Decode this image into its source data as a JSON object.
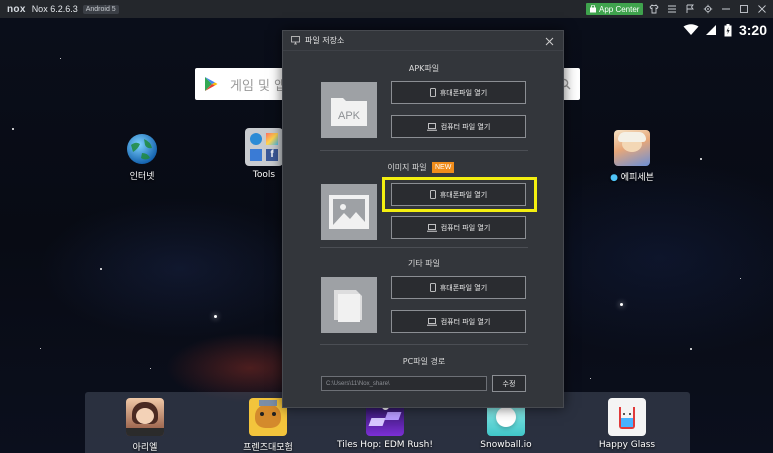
{
  "titlebar": {
    "logo": "nox",
    "version": "Nox 6.2.6.3",
    "android_badge": "Android 5",
    "app_center": "App Center"
  },
  "status_bar": {
    "time": "3:20"
  },
  "search": {
    "placeholder": "게임 및 앱"
  },
  "desktop_icons": [
    {
      "label": "인터넷",
      "icon": "globe-icon"
    },
    {
      "label": "Tools",
      "icon": "tools-folder-icon"
    },
    {
      "label": "에피세븐",
      "icon": "epic-seven-icon"
    }
  ],
  "dock_apps": [
    {
      "label": "아리엘",
      "icon": "ariel-app-icon"
    },
    {
      "label": "프렌즈대모험",
      "icon": "friends-adventure-icon"
    },
    {
      "label": "Tiles Hop: EDM Rush!",
      "icon": "tiles-hop-icon"
    },
    {
      "label": "Snowball.io",
      "icon": "snowball-io-icon"
    },
    {
      "label": "Happy Glass",
      "icon": "happy-glass-icon"
    }
  ],
  "dialog": {
    "title": "파일 저장소",
    "sections": [
      {
        "title": "APK파일",
        "thumb_text": "APK",
        "phone_btn": "휴대폰파일 열기",
        "pc_btn": "컴퓨터 파일 열기"
      },
      {
        "title": "이미지 파일",
        "badge": "NEW",
        "phone_btn": "휴대폰파일 열기",
        "pc_btn": "컴퓨터 파일 열기"
      },
      {
        "title": "기타 파일",
        "phone_btn": "휴대폰파일 열기",
        "pc_btn": "컴퓨터 파일 열기"
      }
    ],
    "pc_path": {
      "title": "PC파일 경로",
      "value": "C:\\Users\\11\\Nox_share\\",
      "edit_label": "수정"
    }
  },
  "colors": {
    "app_center": "#3fa34d",
    "new_badge": "#f08c1a",
    "highlight": "#f4ef10",
    "dialog_bg": "#33363b"
  }
}
